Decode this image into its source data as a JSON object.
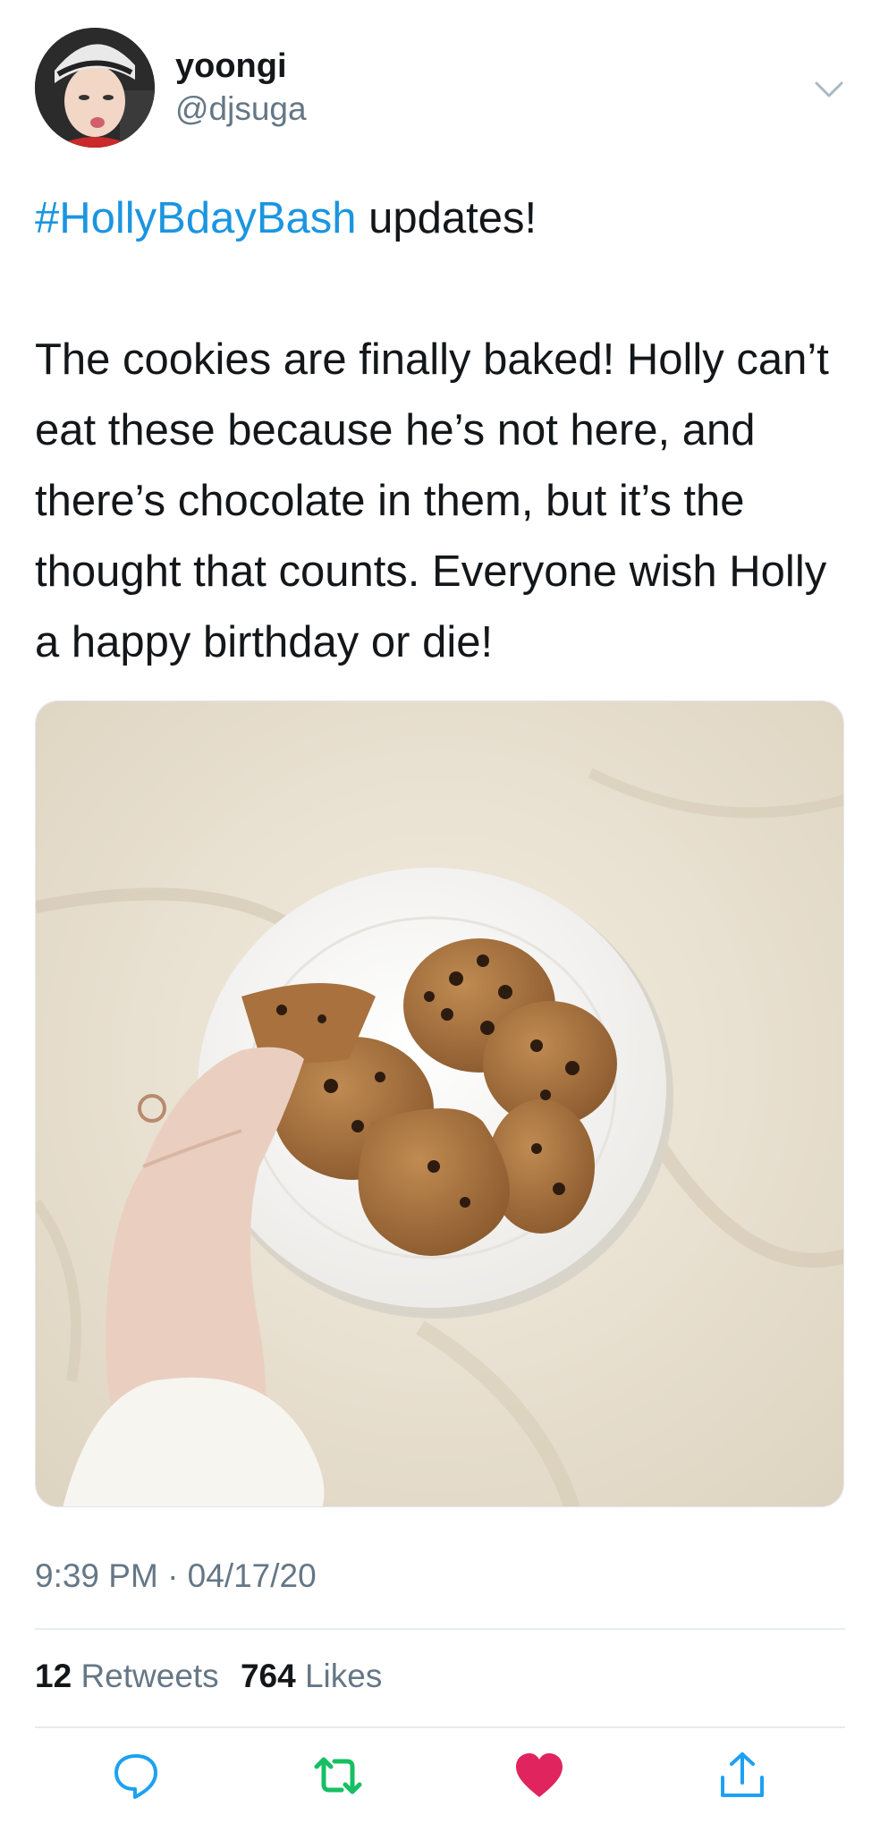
{
  "user": {
    "name": "yoongi",
    "handle": "@djsuga"
  },
  "tweet": {
    "hashtag": "#HollyBdayBash",
    "headline_rest": " updates!",
    "body": "The cookies are finally baked! Holly can’t eat these because he’s not here, and there’s chocolate in them, but it’s the thought that counts. Everyone wish Holly a happy birthday or die!",
    "timestamp": "9:39 PM · 04/17/20"
  },
  "stats": {
    "retweets_count": "12",
    "retweets_label": "Retweets",
    "likes_count": "764",
    "likes_label": "Likes"
  },
  "actions": {
    "reply_icon": "reply-bubble-icon",
    "retweet_icon": "retweet-icon",
    "like_icon": "heart-filled-icon",
    "share_icon": "share-upload-icon",
    "retweet_color": "#17bf63",
    "like_color": "#e0245e"
  },
  "colors": {
    "link": "#1b95e0",
    "secondary_text": "#657786",
    "primary_text": "#14171a"
  }
}
